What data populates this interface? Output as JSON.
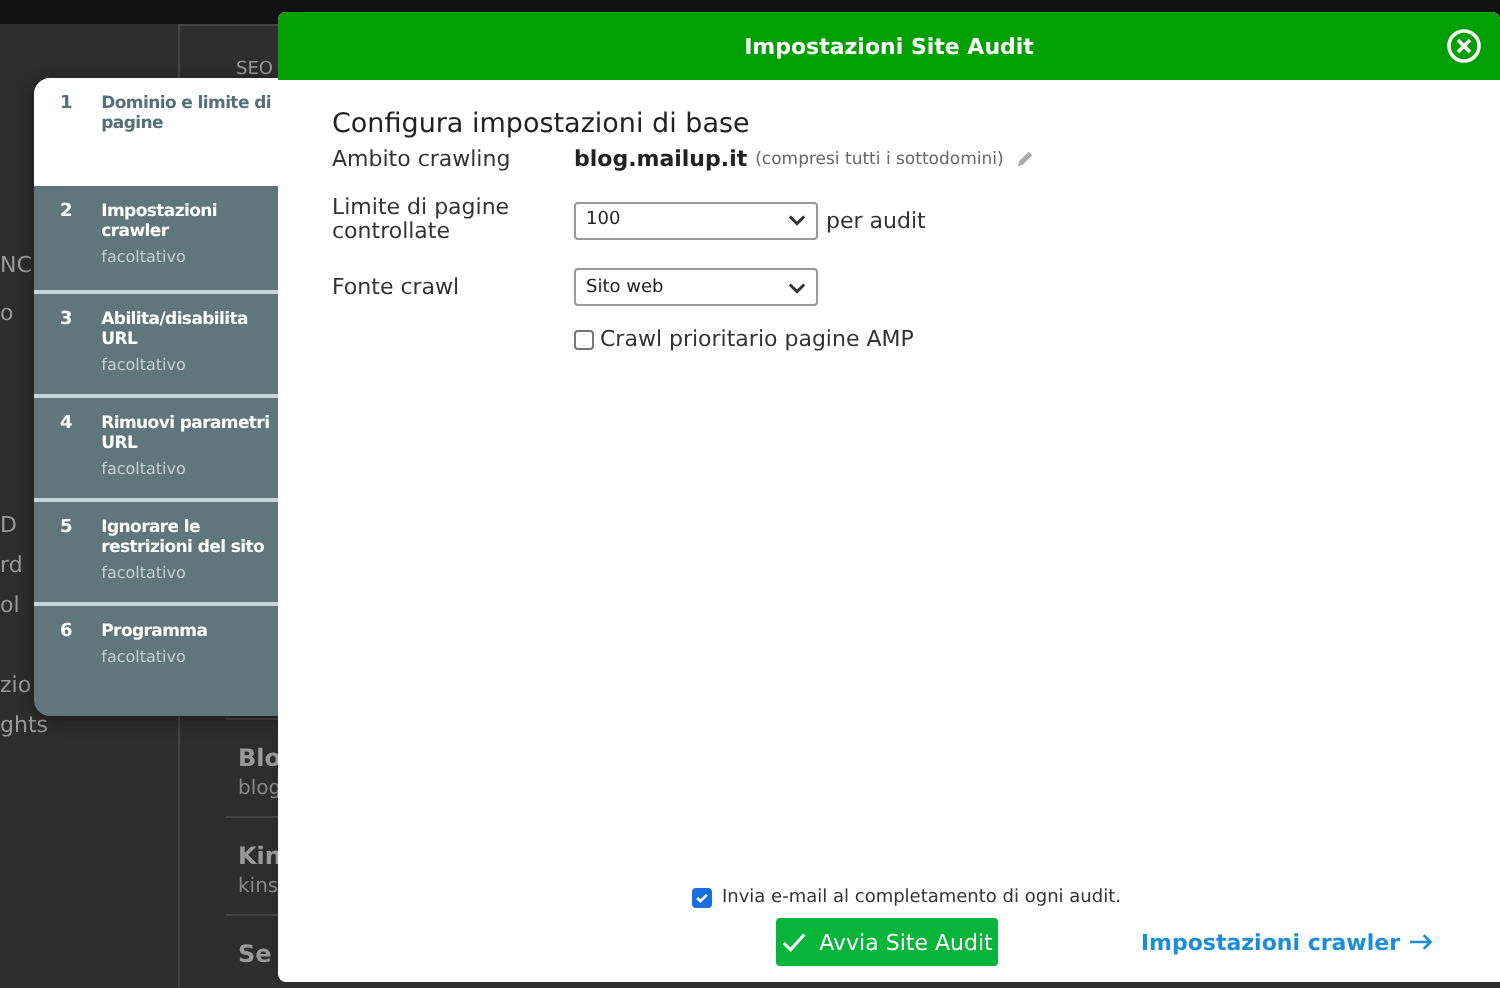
{
  "background_page": {
    "tab": "SEO",
    "sidebar": [
      "NC",
      "o",
      "D",
      "rd",
      "ol",
      "zio",
      "ghts"
    ],
    "list": [
      {
        "title": "Blo",
        "subtitle": "blog"
      },
      {
        "title": "Kin",
        "subtitle": "kins"
      },
      {
        "title": "Se"
      }
    ]
  },
  "dialog": {
    "title": "Impostazioni Site Audit",
    "steps": [
      {
        "number": "1",
        "title": "Dominio e limite di pagine",
        "selected": true
      },
      {
        "number": "2",
        "title": "Impostazioni crawler",
        "subtitle": "facoltativo",
        "selected": false
      },
      {
        "number": "3",
        "title": "Abilita/disabilita URL",
        "subtitle": "facoltativo",
        "selected": false
      },
      {
        "number": "4",
        "title": "Rimuovi parametri URL",
        "subtitle": "facoltativo",
        "selected": false
      },
      {
        "number": "5",
        "title": "Ignorare le restrizioni del sito",
        "subtitle": "facoltativo",
        "selected": false
      },
      {
        "number": "6",
        "title": "Programma",
        "subtitle": "facoltativo",
        "selected": false
      }
    ],
    "section_title": "Configura impostazioni di base",
    "crawl_scope": {
      "label": "Ambito crawling",
      "domain": "blog.mailup.it",
      "note": "(compresi tutti i sottodomini)"
    },
    "page_limit": {
      "label": "Limite di pagine controllate",
      "value": "100",
      "suffix": "per audit"
    },
    "crawl_source": {
      "label": "Fonte crawl",
      "value": "Sito web"
    },
    "amp_option": {
      "label": "Crawl prioritario pagine AMP",
      "checked": false
    },
    "email_option": {
      "label": "Invia e-mail al completamento di ogni audit.",
      "checked": true
    },
    "start_button": "Avvia Site Audit",
    "next_link": "Impostazioni crawler"
  }
}
